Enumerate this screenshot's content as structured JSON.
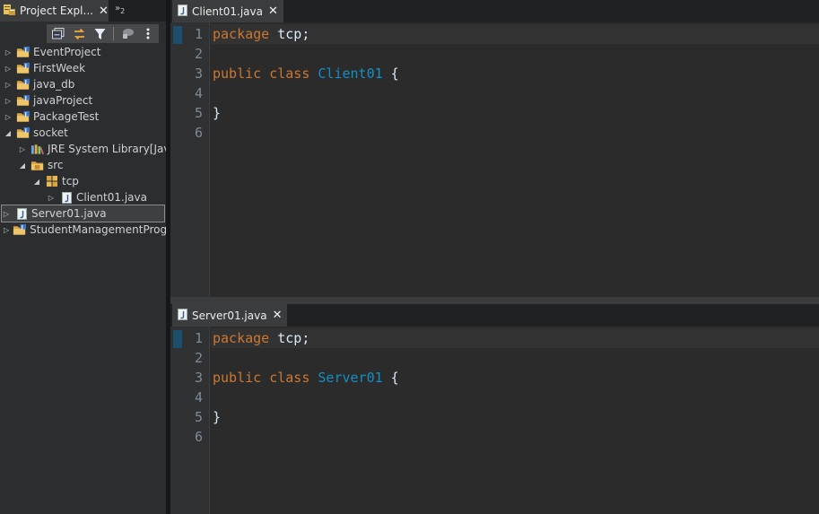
{
  "explorer": {
    "tab_label": "Project Expl...",
    "more_views_label": "»",
    "more_views_count": "2",
    "tree": [
      {
        "label": "EventProject",
        "suffix": "",
        "depth": 0,
        "expanded": false,
        "icon": "java-project-icon"
      },
      {
        "label": "FirstWeek",
        "suffix": "",
        "depth": 0,
        "expanded": false,
        "icon": "java-project-icon"
      },
      {
        "label": "java_db",
        "suffix": "",
        "depth": 0,
        "expanded": false,
        "icon": "java-project-icon"
      },
      {
        "label": "javaProject",
        "suffix": "",
        "depth": 0,
        "expanded": false,
        "icon": "java-project-icon"
      },
      {
        "label": "PackageTest",
        "suffix": "",
        "depth": 0,
        "expanded": false,
        "icon": "java-project-icon"
      },
      {
        "label": "socket",
        "suffix": "",
        "depth": 0,
        "expanded": true,
        "icon": "java-project-icon"
      },
      {
        "label": "JRE System Library",
        "suffix": " [Java",
        "depth": 1,
        "expanded": false,
        "icon": "library-icon"
      },
      {
        "label": "src",
        "suffix": "",
        "depth": 1,
        "expanded": true,
        "icon": "source-folder-icon"
      },
      {
        "label": "tcp",
        "suffix": "",
        "depth": 2,
        "expanded": true,
        "icon": "package-icon"
      },
      {
        "label": "Client01.java",
        "suffix": "",
        "depth": 3,
        "expanded": false,
        "icon": "java-file-icon"
      },
      {
        "label": "Server01.java",
        "suffix": "",
        "depth": 3,
        "expanded": false,
        "icon": "java-file-icon",
        "selected": true
      },
      {
        "label": "StudentManagementProgram",
        "suffix": "",
        "depth": 0,
        "expanded": false,
        "icon": "java-project-icon"
      }
    ]
  },
  "editors": [
    {
      "tab_label": "Client01.java",
      "line_numbers": [
        "1",
        "2",
        "3",
        "4",
        "5",
        "6"
      ],
      "lines": [
        [
          {
            "t": "package",
            "k": "kw"
          },
          {
            "t": " tcp;",
            "k": "txt"
          }
        ],
        [],
        [
          {
            "t": "public",
            "k": "kw"
          },
          {
            "t": " ",
            "k": "txt"
          },
          {
            "t": "class",
            "k": "kw"
          },
          {
            "t": " ",
            "k": "txt"
          },
          {
            "t": "Client01",
            "k": "cls"
          },
          {
            "t": " {",
            "k": "txt"
          }
        ],
        [],
        [
          {
            "t": "}",
            "k": "txt"
          }
        ],
        []
      ]
    },
    {
      "tab_label": "Server01.java",
      "line_numbers": [
        "1",
        "2",
        "3",
        "4",
        "5",
        "6"
      ],
      "lines": [
        [
          {
            "t": "package",
            "k": "kw"
          },
          {
            "t": " tcp;",
            "k": "txt"
          }
        ],
        [],
        [
          {
            "t": "public",
            "k": "kw"
          },
          {
            "t": " ",
            "k": "txt"
          },
          {
            "t": "class",
            "k": "kw"
          },
          {
            "t": " ",
            "k": "txt"
          },
          {
            "t": "Server01",
            "k": "cls"
          },
          {
            "t": " {",
            "k": "txt"
          }
        ],
        [],
        [
          {
            "t": "}",
            "k": "txt"
          }
        ],
        []
      ]
    }
  ],
  "colors": {
    "keyword": "#cc7832",
    "class_name": "#1290c3",
    "text": "#d9e8f7",
    "line_number": "#7e8a95"
  }
}
